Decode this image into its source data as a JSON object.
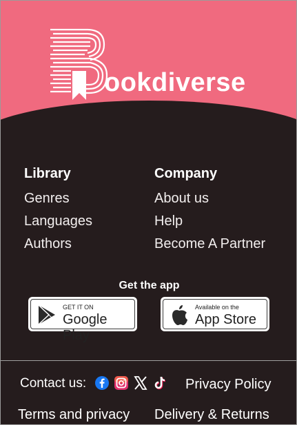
{
  "brand": {
    "name": "ookdiverse",
    "logo_icon": "book-bookmark-icon",
    "primary_color": "#f06a7f",
    "dark_color": "#251c1d"
  },
  "library": {
    "heading": "Library",
    "links": [
      "Genres",
      "Languages",
      "Authors"
    ]
  },
  "company": {
    "heading": "Company",
    "links": [
      "About us",
      "Help",
      "Become A Partner"
    ]
  },
  "get_app": {
    "label": "Get the app",
    "google": {
      "small": "GET IT ON",
      "big": "Google Play",
      "icon": "google-play-icon"
    },
    "apple": {
      "small": "Available on the",
      "big": "App Store",
      "icon": "apple-icon"
    }
  },
  "contact": {
    "label": "Contact us:",
    "socials": [
      "facebook-icon",
      "instagram-icon",
      "x-icon",
      "tiktok-icon"
    ]
  },
  "footer": {
    "privacy": "Privacy Policy",
    "terms": "Terms and privacy",
    "delivery": "Delivery & Returns"
  }
}
